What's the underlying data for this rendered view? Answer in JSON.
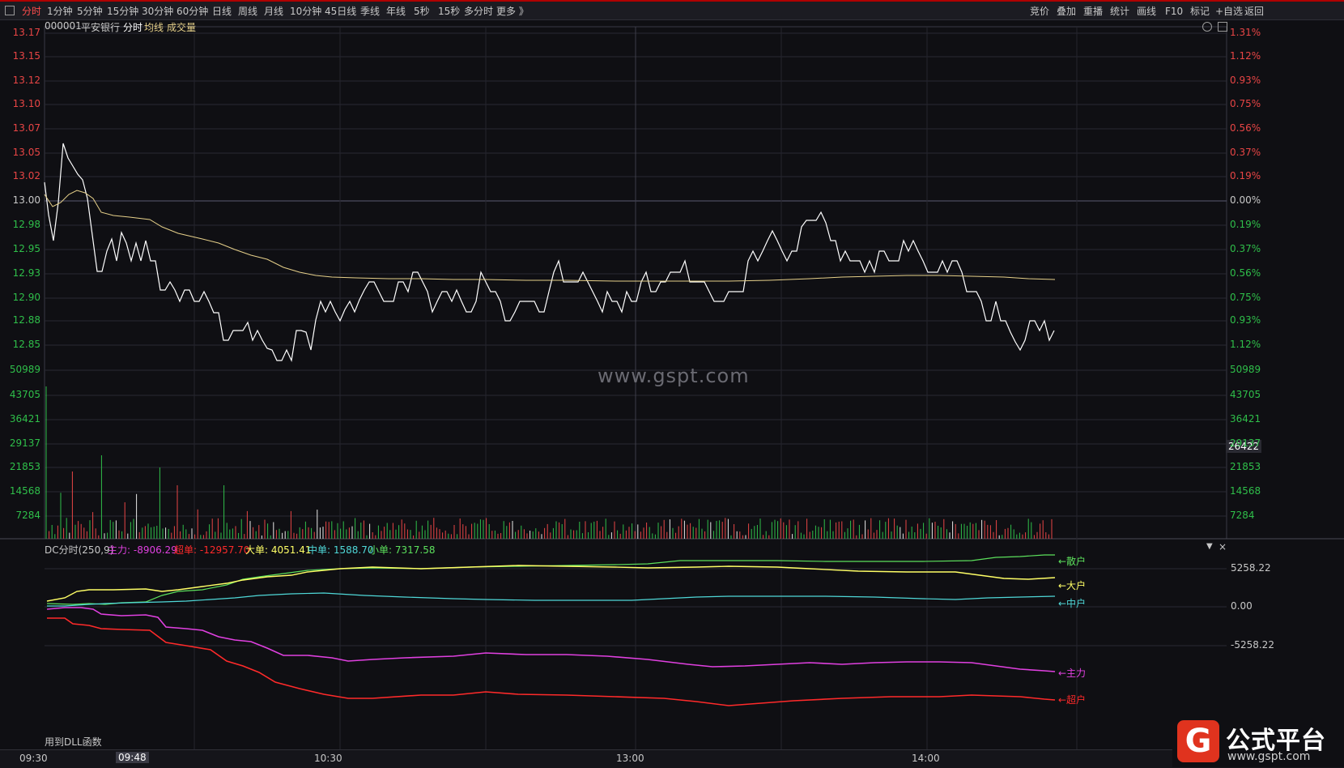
{
  "toolbar": {
    "left_items": [
      "分时",
      "1分钟",
      "5分钟",
      "15分钟",
      "30分钟",
      "60分钟",
      "日线",
      "周线",
      "月线",
      "10分钟",
      "45日线",
      "季线",
      "年线",
      "5秒",
      "15秒",
      "多分时",
      "更多 》"
    ],
    "right_items": [
      "竞价",
      "叠加",
      "重播",
      "统计",
      "画线",
      "F10",
      "标记",
      "+自选",
      "返回"
    ]
  },
  "header": {
    "code": "000001",
    "name": "平安银行",
    "tab": "分时",
    "avg_label": "均线",
    "volume_label": "成交量"
  },
  "price_axis": {
    "left": [
      "13.17",
      "13.15",
      "13.12",
      "13.10",
      "13.07",
      "13.05",
      "13.02",
      "13.00",
      "12.98",
      "12.95",
      "12.93",
      "12.90",
      "12.88",
      "12.85"
    ],
    "right": [
      "1.31%",
      "1.12%",
      "0.93%",
      "0.75%",
      "0.56%",
      "0.37%",
      "0.19%",
      "0.00%",
      "0.19%",
      "0.37%",
      "0.56%",
      "0.75%",
      "0.93%",
      "1.12%"
    ]
  },
  "volume_axis": {
    "labels": [
      "50989",
      "43705",
      "36421",
      "29137",
      "21853",
      "14568",
      "7284"
    ],
    "current": "26422"
  },
  "indicator": {
    "title": "DC分时(250,9)",
    "main_label": "主力: -8906.29",
    "super_label": "超单: -12957.70",
    "large_label": "大单: 4051.41",
    "mid_label": "中单: 1588.70",
    "small_label": "小单: 7317.58",
    "axis": [
      "5258.22",
      "0.00",
      "-5258.22"
    ],
    "tags": {
      "retail": "←散户",
      "large": "←大户",
      "mid": "←中户",
      "main": "←主力",
      "super": "←超户"
    },
    "footer": "用到DLL函数"
  },
  "time_axis": {
    "labels": [
      "09:30",
      "09:48",
      "10:30",
      "13:00",
      "14:00"
    ],
    "selected": "09:48"
  },
  "watermark": "www.gspt.com",
  "brand": {
    "logo": "G",
    "name": "公式平台",
    "url": "www.gspt.com"
  },
  "colors": {
    "up": "#e84545",
    "down": "#2fbf4a",
    "price_line": "#ffffff",
    "avg_line": "#e6d08a",
    "main": "#e040e0",
    "super": "#ff2a2a",
    "large": "#ffff66",
    "mid": "#4fd8d8",
    "retail": "#5ce05c"
  }
}
